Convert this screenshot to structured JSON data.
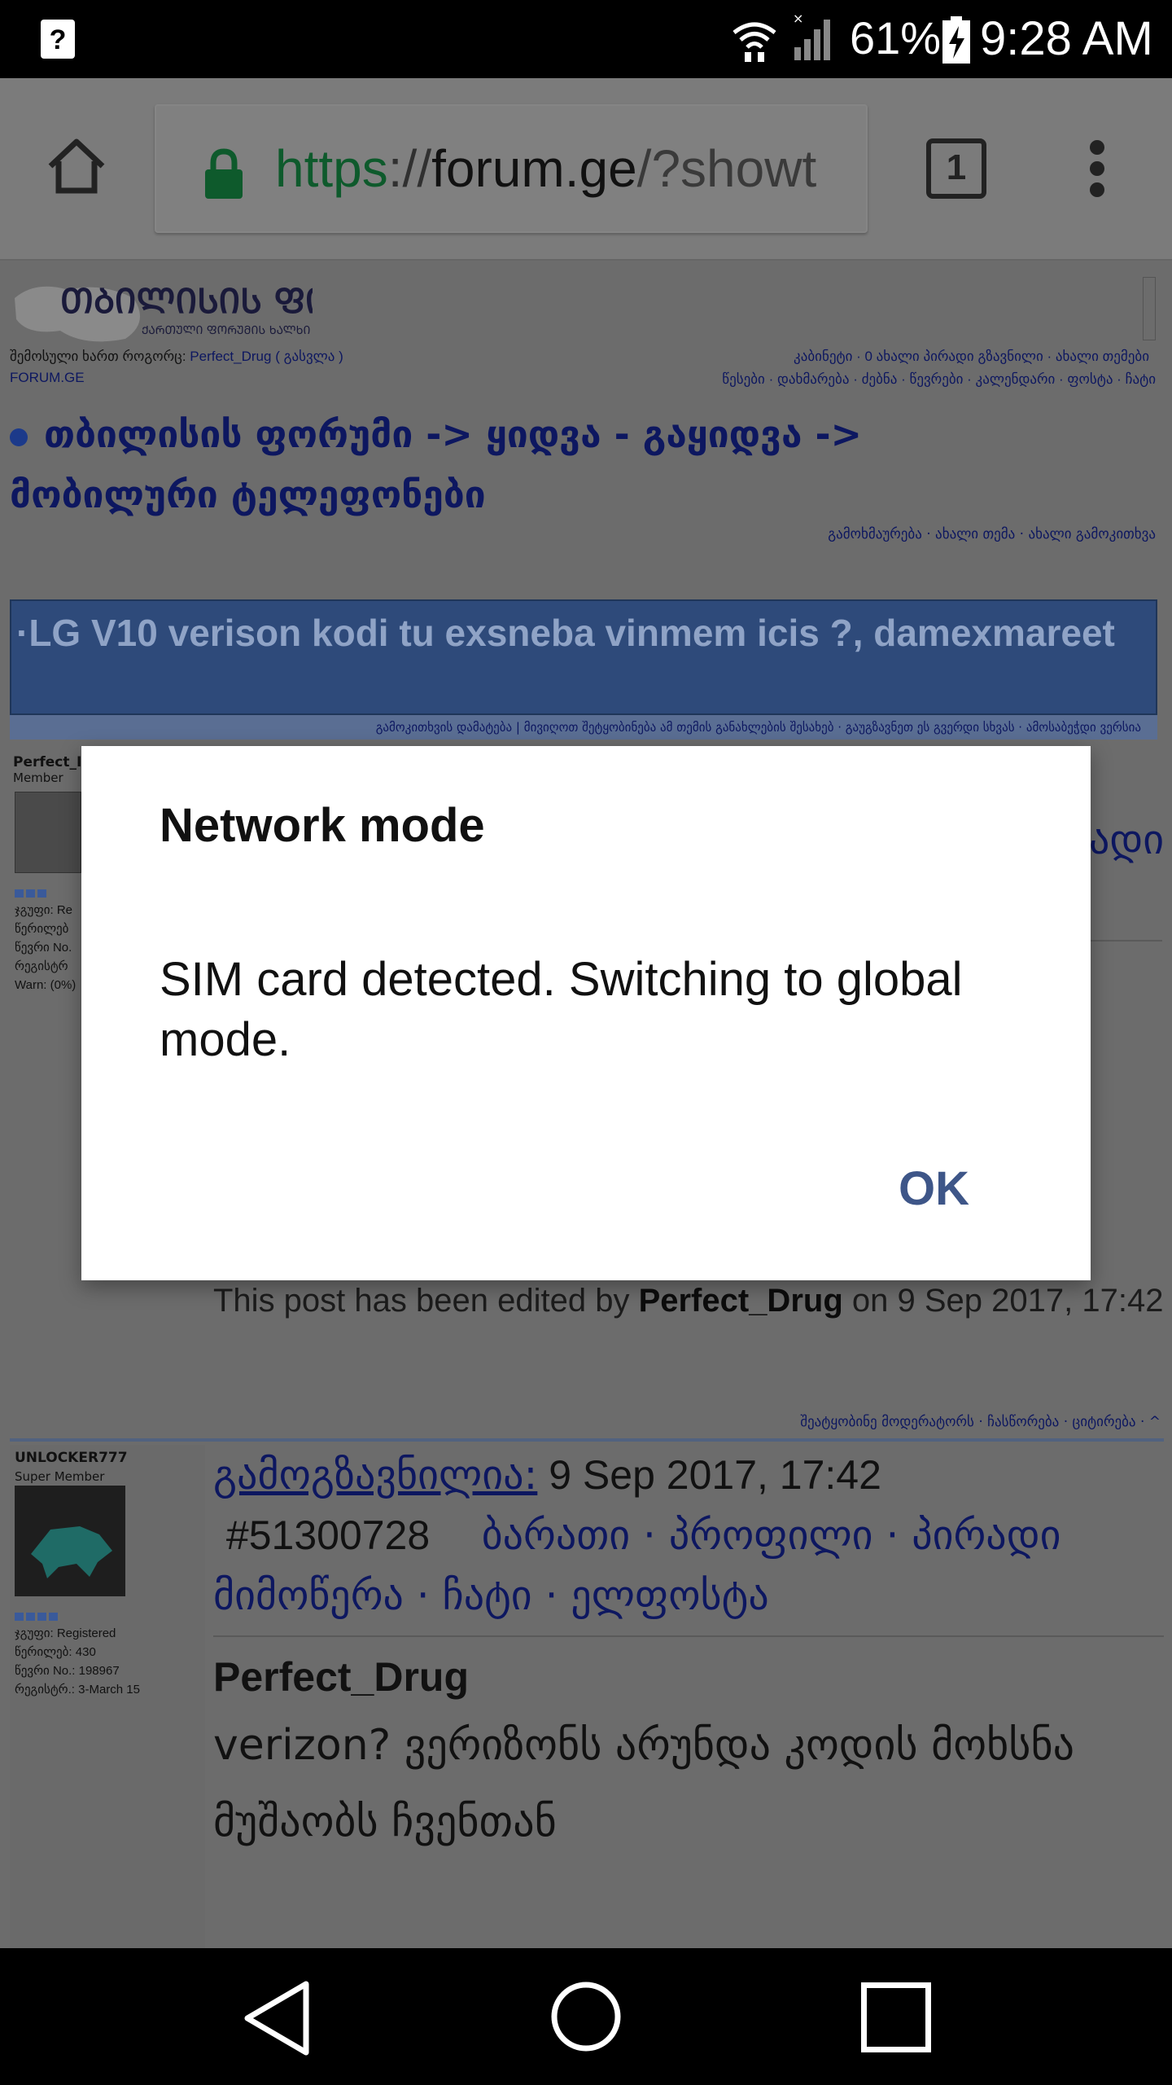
{
  "status_bar": {
    "battery_percent": "61%",
    "time": "9:28 AM",
    "notification_icon_text": "?"
  },
  "browser": {
    "url_scheme": "https",
    "url_separator": "://",
    "url_domain": "forum.ge",
    "url_path": "/?showt",
    "tab_count": "1"
  },
  "forum": {
    "login_prefix": "შემოსული ხართ როგორც:",
    "username": "Perfect_Drug",
    "logout": "( გასვლა )",
    "site_label": "FORUM.GE",
    "top_links_1": "კაბინეტი · 0 ახალი პირადი გზავნილი · ახალი თემები",
    "top_links_2": "წესები · დახმარება · ძებნა · წევრები · კალენდარი · ფოსტა · ჩატი",
    "breadcrumb_title": "თბილისის ფორუმი -> ყიდვა - გაყიდვა -> მობილური ტელეფონები",
    "action_links": "გამოხმაურება · ახალი თემა · ახალი გამოკითხვა",
    "topic_title": "LG V10 verison kodi tu exsneba vinmem icis ?, damexmareet",
    "topic_tools": "გამოკითხვის დამატება   |   მივიღოთ შეტყობინება ამ თემის განახლების შესახებ   ·   გაუგზავნეთ ეს გვერდი სხვას   ·   ამოსაბეჭდი ვერსია"
  },
  "post1": {
    "user": "Perfect_I",
    "rank": "Member",
    "stats": [
      "ჯგუფი: Re",
      "წერილებ",
      "წევრი No.",
      "რეგისტრ",
      "Warn: (0%)"
    ],
    "right_fragment": "ადი",
    "edited_prefix": "This post has been edited by ",
    "edited_user": "Perfect_Drug",
    "edited_suffix": " on 9 Sep 2017, 17:42",
    "footer_links": "შეატყობინე მოდერატორს · ჩასწორება · ციტირება · ^"
  },
  "post2": {
    "user": "UNLOCKER777",
    "rank": "Super Member",
    "stats": [
      "ჯგუფი: Registered",
      "წერილებ: 430",
      "წევრი No.: 198967",
      "რეგისტრ.: 3-March 15"
    ],
    "posted_label": "გამოგზავნილია:",
    "posted_date": " 9 Sep 2017, 17:42",
    "post_number": "#51300728",
    "profile_links": "ბარათი · პროფილი · პირადი მიმოწერა · ჩატი · ელფოსტა",
    "quote_author": "Perfect_Drug",
    "body": "verizon? ვერიზონს არუნდა კოდის მოხსნა მუშაობს ჩვენთან"
  },
  "dialog": {
    "title": "Network mode",
    "message": "SIM card detected. Switching to global mode.",
    "ok_label": "OK"
  }
}
